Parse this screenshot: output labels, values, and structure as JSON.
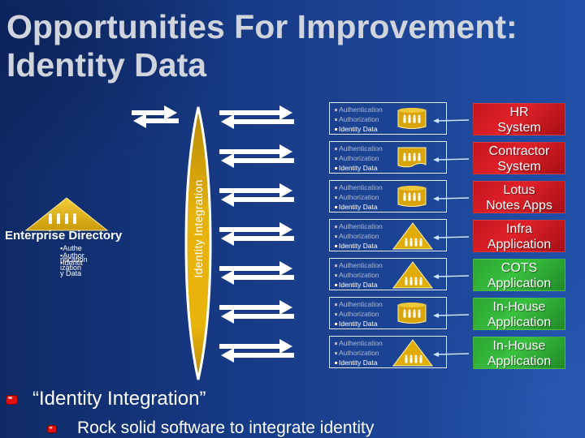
{
  "slide": {
    "title_line1": "Opportunities For Improvement:",
    "title_line2": "Identity Data"
  },
  "enterprise_directory": {
    "label": "Enterprise Directory",
    "icon": "people-triangle-icon",
    "bullets": [
      "▪Authe",
      "▪Author",
      "ntication",
      "▪Identit",
      "ization",
      "y Data"
    ]
  },
  "integration_hub": {
    "label": "Identity Integration",
    "color": "#e8b40c"
  },
  "rows": [
    {
      "auth": "Authentication",
      "authz": "Authorization",
      "identity": "Identity Data",
      "store_icon": "database-cylinder-icon",
      "system_line1": "HR",
      "system_line2": "System",
      "system_color": "red"
    },
    {
      "auth": "Authentication",
      "authz": "Authorization",
      "identity": "Identity Data",
      "store_icon": "document-store-icon",
      "system_line1": "Contractor",
      "system_line2": "System",
      "system_color": "red"
    },
    {
      "auth": "Authentication",
      "authz": "Authorization",
      "identity": "Identity Data",
      "store_icon": "database-cylinder-icon",
      "system_line1": "Lotus",
      "system_line2": "Notes Apps",
      "system_color": "red"
    },
    {
      "auth": "Authentication",
      "authz": "Authorization",
      "identity": "Identity Data",
      "store_icon": "directory-triangle-icon",
      "system_line1": "Infra",
      "system_line2": "Application",
      "system_color": "red"
    },
    {
      "auth": "Authentication",
      "authz": "Authorization",
      "identity": "Identity Data",
      "store_icon": "directory-triangle-icon",
      "system_line1": "COTS",
      "system_line2": "Application",
      "system_color": "green"
    },
    {
      "auth": "Authentication",
      "authz": "Authorization",
      "identity": "Identity Data",
      "store_icon": "database-cylinder-icon",
      "system_line1": "In-House",
      "system_line2": "Application",
      "system_color": "green"
    },
    {
      "auth": "Authentication",
      "authz": "Authorization",
      "identity": "Identity Data",
      "store_icon": "directory-triangle-icon",
      "system_line1": "In-House",
      "system_line2": "Application",
      "system_color": "green"
    }
  ],
  "bullets": {
    "level1": "“Identity Integration”",
    "level2": "Rock solid software to integrate identity"
  },
  "colors": {
    "background": "#173a85",
    "system_red": "#d81b22",
    "system_green": "#33b53a",
    "gold": "#e8b40c",
    "bullet_red": "#e01010"
  }
}
